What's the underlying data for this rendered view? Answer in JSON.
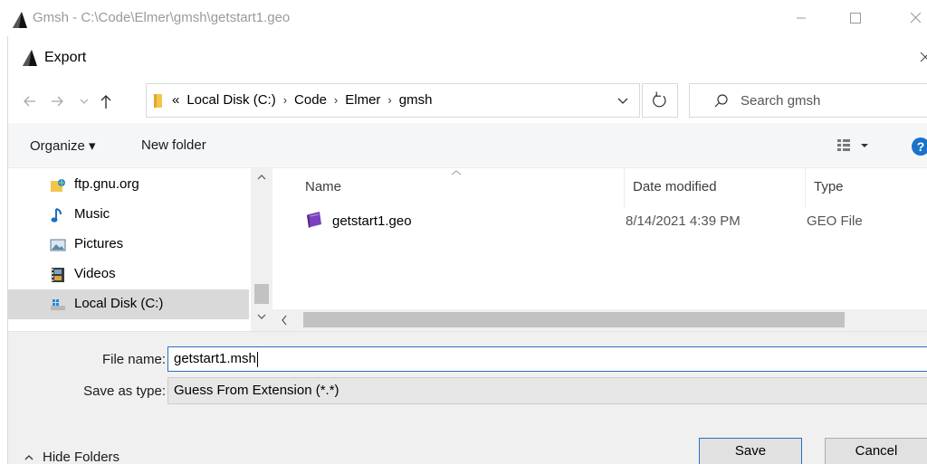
{
  "window": {
    "title": "Gmsh - C:\\Code\\Elmer\\gmsh\\getstart1.geo"
  },
  "dialog": {
    "title": "Export"
  },
  "address": {
    "crumbs": [
      "«",
      "Local Disk (C:)",
      "Code",
      "Elmer",
      "gmsh"
    ],
    "search_placeholder": "Search gmsh"
  },
  "toolbar": {
    "organize": "Organize ▾",
    "new_folder": "New folder",
    "help": "?"
  },
  "nav": {
    "items": [
      {
        "label": "ftp.gnu.org",
        "icon": "network-folder-icon"
      },
      {
        "label": "Music",
        "icon": "music-icon"
      },
      {
        "label": "Pictures",
        "icon": "pictures-icon"
      },
      {
        "label": "Videos",
        "icon": "videos-icon"
      },
      {
        "label": "Local Disk (C:)",
        "icon": "drive-icon",
        "selected": true
      }
    ]
  },
  "list": {
    "columns": [
      "Name",
      "Date modified",
      "Type"
    ],
    "rows": [
      {
        "name": "getstart1.geo",
        "date": "8/14/2021 4:39 PM",
        "type": "GEO File",
        "icon": "geo-file-icon"
      }
    ]
  },
  "form": {
    "file_name_label": "File name:",
    "file_name_value": "getstart1.msh",
    "save_type_label": "Save as type:",
    "save_type_value": "Guess From Extension (*.*)",
    "hide_folders": "Hide Folders",
    "save": "Save",
    "cancel": "Cancel"
  },
  "colors": {
    "accent": "#2c6fbf",
    "selection": "#d9d9d9",
    "help_bg": "#1a73c9"
  }
}
